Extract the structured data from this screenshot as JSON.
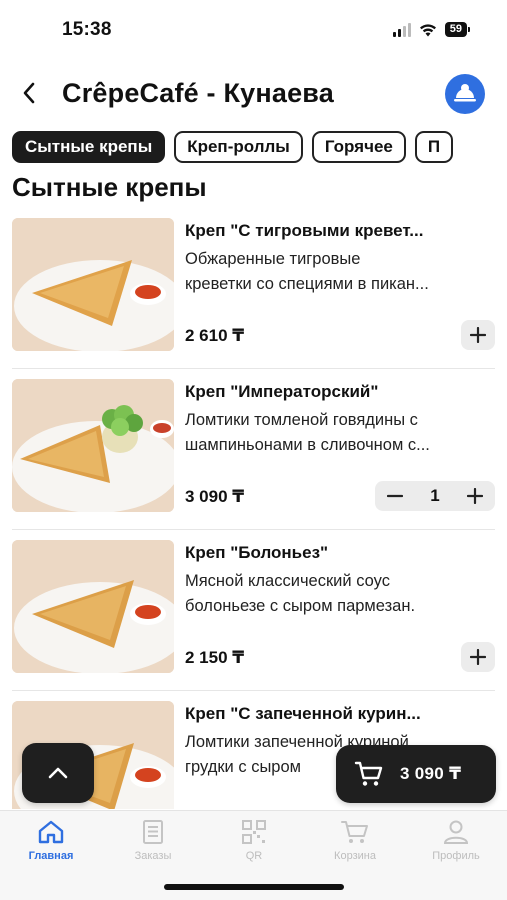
{
  "status": {
    "time": "15:38",
    "battery": "59"
  },
  "header": {
    "title": "CrêpeCafé - Кунаева"
  },
  "categories": [
    "Сытные крепы",
    "Креп-роллы",
    "Горячее",
    "П"
  ],
  "section_title": "Сытные крепы",
  "items": [
    {
      "name": "Креп \"С тигровыми кревет...",
      "desc_line1": "Обжаренные тигровые",
      "desc_line2": "креветки со специями в пикан...",
      "price": "2 610 ₸"
    },
    {
      "name": "Креп \"Императорский\"",
      "desc_line1": "Ломтики томленой говядины с",
      "desc_line2": "шампиньонами в сливочном с...",
      "price": "3 090 ₸",
      "quantity": "1"
    },
    {
      "name": "Креп  \"Болоньез\"",
      "desc_line1": "Мясной классический соус",
      "desc_line2": "болоньезе с сыром пармезан.",
      "price": "2 150 ₸"
    },
    {
      "name": "Креп \"С запеченной курин...",
      "desc_line1": "Ломтики запеченной куриной",
      "desc_line2": "грудки с сыром"
    }
  ],
  "cart": {
    "total": "3 090 ₸"
  },
  "nav": [
    "Главная",
    "Заказы",
    "QR",
    "Корзина",
    "Профиль"
  ],
  "colors": {
    "accent": "#2f6fe0",
    "dark": "#1f1f1f"
  }
}
